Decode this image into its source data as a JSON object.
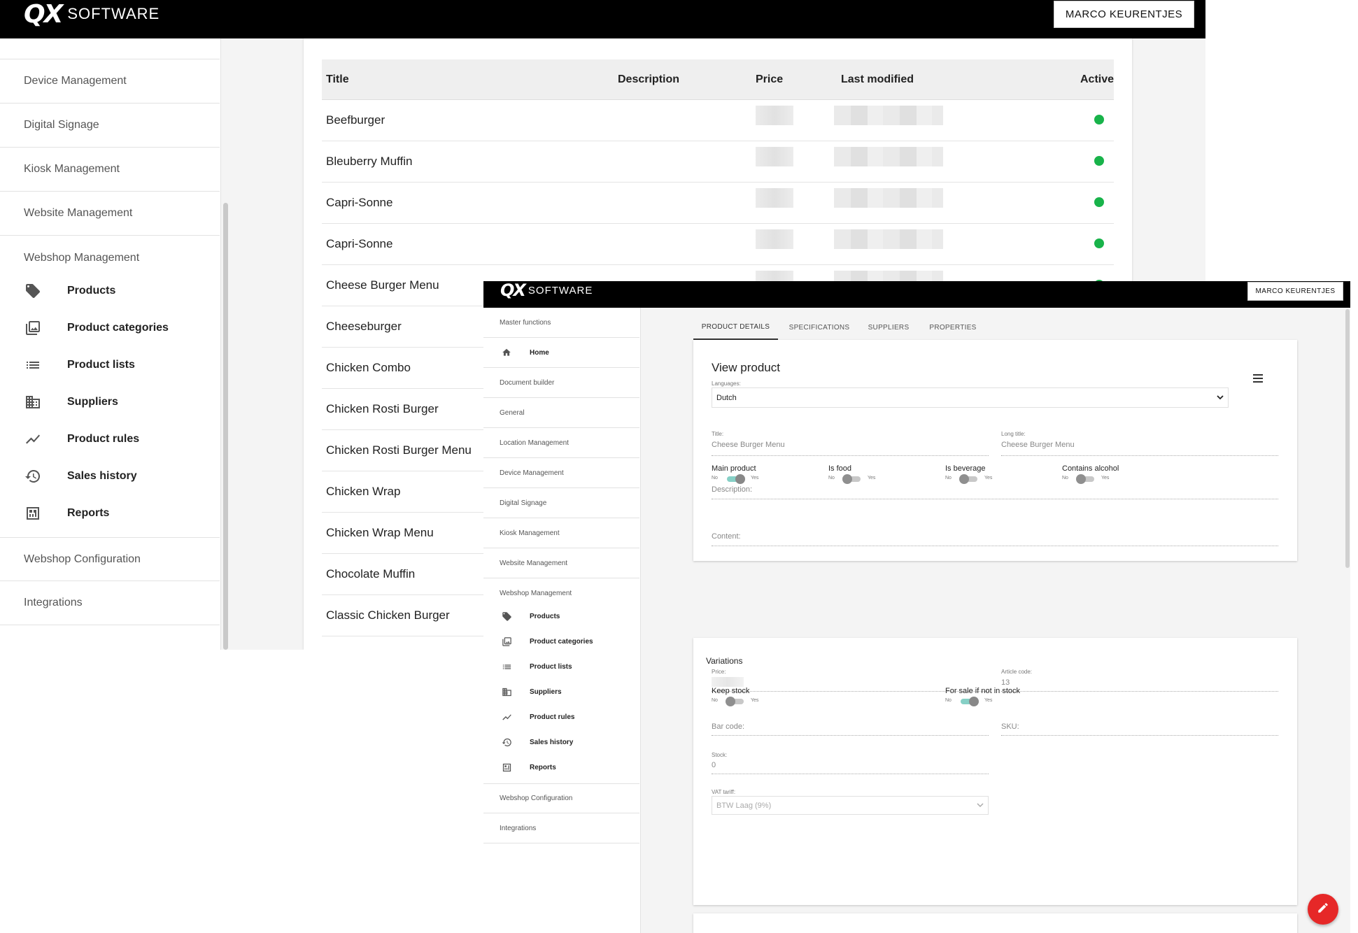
{
  "bg": {
    "brand": {
      "mark": "QX",
      "word": "SOFTWARE"
    },
    "user_button": "MARCO KEURENTJES",
    "sidebar": {
      "sections": [
        {
          "label": "Device Management"
        },
        {
          "label": "Digital Signage"
        },
        {
          "label": "Kiosk Management"
        },
        {
          "label": "Website Management"
        },
        {
          "label": "Webshop Management"
        }
      ],
      "sub_items": [
        {
          "label": "Products",
          "icon": "tag-icon"
        },
        {
          "label": "Product categories",
          "icon": "image-gallery-icon"
        },
        {
          "label": "Product lists",
          "icon": "list-icon"
        },
        {
          "label": "Suppliers",
          "icon": "building-icon"
        },
        {
          "label": "Product rules",
          "icon": "trend-icon"
        },
        {
          "label": "Sales history",
          "icon": "history-icon"
        },
        {
          "label": "Reports",
          "icon": "report-icon"
        }
      ],
      "after_sections": [
        {
          "label": "Webshop Configuration"
        },
        {
          "label": "Integrations"
        }
      ]
    },
    "table": {
      "headers": {
        "title": "Title",
        "description": "Description",
        "price": "Price",
        "last_modified": "Last modified",
        "active": "Active"
      },
      "rows": [
        {
          "title": "Beefburger",
          "active": true
        },
        {
          "title": "Bleuberry Muffin",
          "active": true
        },
        {
          "title": "Capri-Sonne",
          "active": true
        },
        {
          "title": "Capri-Sonne",
          "active": true
        },
        {
          "title": "Cheese Burger Menu",
          "active": true
        },
        {
          "title": "Cheeseburger",
          "active": true
        },
        {
          "title": "Chicken Combo",
          "active": true
        },
        {
          "title": "Chicken Rosti Burger",
          "active": true
        },
        {
          "title": "Chicken Rosti Burger Menu",
          "active": true
        },
        {
          "title": "Chicken Wrap",
          "active": true
        },
        {
          "title": "Chicken Wrap Menu",
          "active": true
        },
        {
          "title": "Chocolate Muffin",
          "active": true
        },
        {
          "title": "Classic Chicken Burger",
          "active": true
        }
      ],
      "active_color": "#18b34a"
    }
  },
  "fg": {
    "brand": {
      "mark": "QX",
      "word": "SOFTWARE"
    },
    "user_button": "MARCO KEURENTJES",
    "sidebar": {
      "master": "Master functions",
      "home": {
        "label": "Home",
        "icon": "home-icon"
      },
      "sections": [
        {
          "label": "Document builder"
        },
        {
          "label": "General"
        },
        {
          "label": "Location Management"
        },
        {
          "label": "Device Management"
        },
        {
          "label": "Digital Signage"
        },
        {
          "label": "Kiosk Management"
        },
        {
          "label": "Website Management"
        },
        {
          "label": "Webshop Management"
        }
      ],
      "sub_items": [
        {
          "label": "Products",
          "icon": "tag-icon"
        },
        {
          "label": "Product categories",
          "icon": "image-gallery-icon"
        },
        {
          "label": "Product lists",
          "icon": "list-icon"
        },
        {
          "label": "Suppliers",
          "icon": "building-icon"
        },
        {
          "label": "Product rules",
          "icon": "trend-icon"
        },
        {
          "label": "Sales history",
          "icon": "history-icon"
        },
        {
          "label": "Reports",
          "icon": "report-icon"
        }
      ],
      "after_sections": [
        {
          "label": "Webshop Configuration"
        },
        {
          "label": "Integrations"
        }
      ]
    },
    "tabs": [
      "PRODUCT DETAILS",
      "SPECIFICATIONS",
      "SUPPLIERS",
      "PROPERTIES"
    ],
    "active_tab": "PRODUCT DETAILS",
    "view": {
      "title": "View product",
      "languages_label": "Languages:",
      "language": "Dutch",
      "title_label": "Title:",
      "title_value": "Cheese Burger Menu",
      "long_title_label": "Long title:",
      "long_title_value": "Cheese Burger Menu",
      "description_placeholder": "Description:",
      "content_placeholder": "Content:",
      "switches": [
        {
          "label": "Main product",
          "no": "No",
          "yes": "Yes",
          "on": true
        },
        {
          "label": "Is food",
          "no": "No",
          "yes": "Yes",
          "on": false
        },
        {
          "label": "Is beverage",
          "no": "No",
          "yes": "Yes",
          "on": false
        },
        {
          "label": "Contains alcohol",
          "no": "No",
          "yes": "Yes",
          "on": false
        }
      ]
    },
    "variations": {
      "title": "Variations",
      "price_label": "Price:",
      "article_code_label": "Article code:",
      "article_code": "13",
      "bar_code_placeholder": "Bar code:",
      "sku_placeholder": "SKU:",
      "stock_label": "Stock:",
      "stock": "0",
      "vat_label": "VAT tariff:",
      "vat_value": "BTW Laag (9%)",
      "keep_stock": {
        "label": "Keep stock",
        "no": "No",
        "yes": "Yes",
        "on": false
      },
      "for_sale": {
        "label": "For sale if not in stock",
        "no": "No",
        "yes": "Yes",
        "on": true
      }
    },
    "fab_icon": "pencil-icon",
    "accent": "#e62828",
    "switch_on_color": "#86d0c6"
  }
}
